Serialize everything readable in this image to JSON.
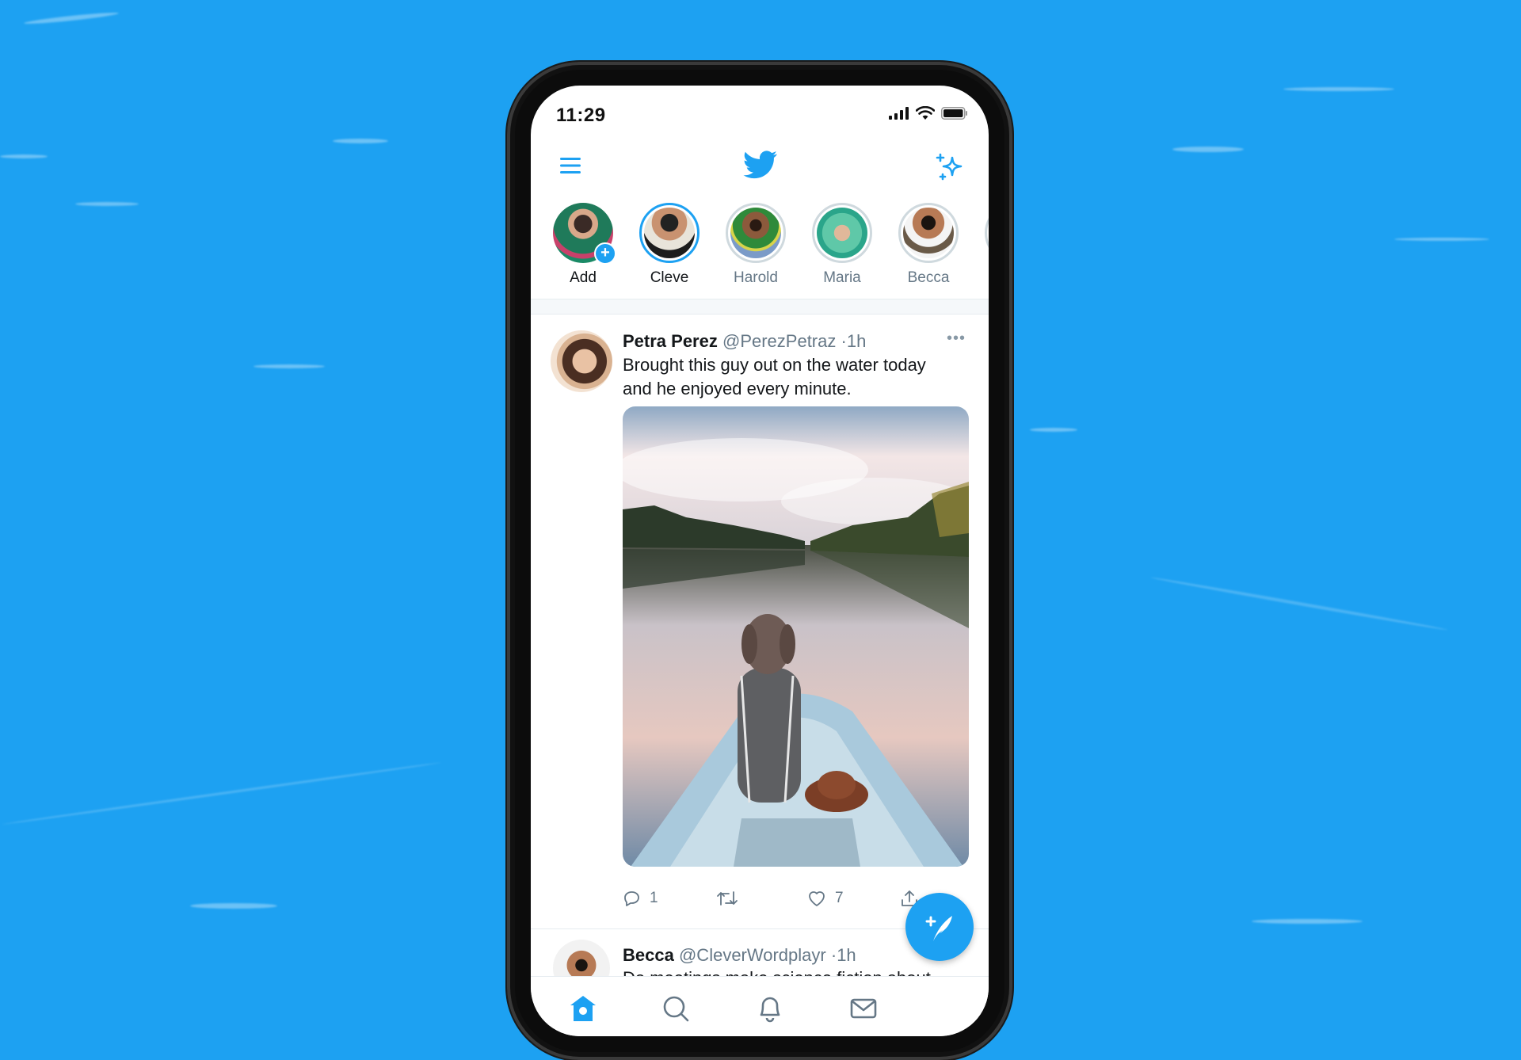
{
  "colors": {
    "background": "#1DA1F2",
    "accent": "#1DA1F2",
    "text_primary": "#14171A",
    "text_secondary": "#657786",
    "divider": "#E6ECF0"
  },
  "status_bar": {
    "time": "11:29",
    "icons": [
      "cellular-signal-icon",
      "wifi-icon",
      "battery-icon"
    ]
  },
  "header": {
    "left_icon": "hamburger-menu-icon",
    "center_icon": "twitter-bird-logo",
    "right_icon": "sparkle-icon"
  },
  "stories": [
    {
      "label": "Add",
      "state": "add",
      "highlight": false
    },
    {
      "label": "Cleve",
      "state": "unseen",
      "highlight": true
    },
    {
      "label": "Harold",
      "state": "seen",
      "highlight": false
    },
    {
      "label": "Maria",
      "state": "seen",
      "highlight": false
    },
    {
      "label": "Becca",
      "state": "seen",
      "highlight": false
    }
  ],
  "tweets": [
    {
      "name": "Petra Perez",
      "handle": "@PerezPetraz",
      "separator": "·",
      "time": "1h",
      "more_icon": "•••",
      "text_line1": "Brought this guy out on the water today",
      "text_line2": "and he enjoyed every minute.",
      "media_alt": "Dog wrapped in a blanket sitting at the bow of a boat on a calm lake",
      "actions": {
        "reply_count": "1",
        "retweet_count": "",
        "like_count": "7",
        "share_label": ""
      }
    },
    {
      "name": "Becca",
      "handle": "@CleverWordplayr",
      "separator": "·",
      "time": "1h",
      "text_line1": "Do meetings make science fiction about"
    }
  ],
  "fab": {
    "icon": "compose-tweet-icon",
    "label": "+"
  },
  "bottom_nav": [
    {
      "name": "home",
      "icon": "home-icon",
      "active": true
    },
    {
      "name": "search",
      "icon": "search-icon",
      "active": false
    },
    {
      "name": "notifications",
      "icon": "bell-icon",
      "active": false
    },
    {
      "name": "messages",
      "icon": "mail-icon",
      "active": false
    }
  ]
}
